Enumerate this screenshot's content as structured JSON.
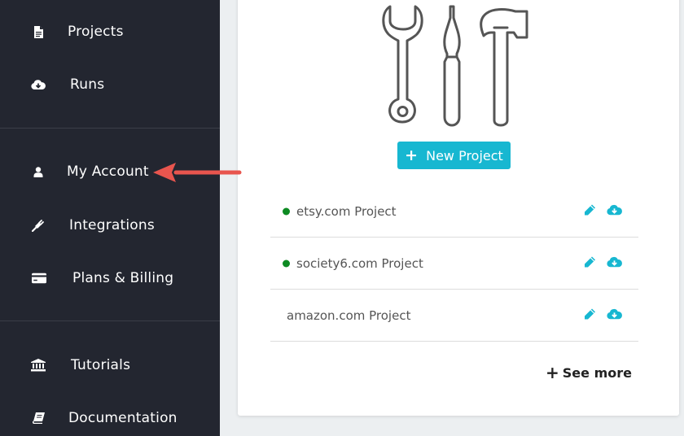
{
  "sidebar": {
    "items": [
      {
        "label": "Projects",
        "icon": "document-icon"
      },
      {
        "label": "Runs",
        "icon": "cloud-download-icon"
      },
      {
        "label": "My Account",
        "icon": "user-icon"
      },
      {
        "label": "Integrations",
        "icon": "plug-icon"
      },
      {
        "label": "Plans & Billing",
        "icon": "credit-card-icon"
      },
      {
        "label": "Tutorials",
        "icon": "institution-icon"
      },
      {
        "label": "Documentation",
        "icon": "book-icon"
      }
    ]
  },
  "main": {
    "illustration": "tools-icon",
    "new_project_label": "New Project",
    "projects": [
      {
        "name": "etsy.com Project",
        "status": "active"
      },
      {
        "name": "society6.com Project",
        "status": "active"
      },
      {
        "name": "amazon.com Project",
        "status": "inactive"
      }
    ],
    "see_more_label": "See more"
  },
  "colors": {
    "sidebar_bg": "#232630",
    "accent": "#17b7d1",
    "status_active": "#0d8a22",
    "annotation_arrow": "#e8554e"
  }
}
